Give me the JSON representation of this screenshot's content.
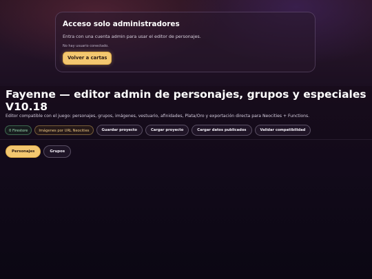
{
  "login": {
    "title": "Acceso solo administradores",
    "description": "Entra con una cuenta admin para usar el editor de personajes.",
    "status": "No hay usuario conectado.",
    "back_button": "Volver a cartas"
  },
  "header": {
    "title": "Fayenne — editor admin de personajes, grupos y especiales V10.18",
    "subtitle": "Editor compatible con el juego: personajes, grupos, imágenes, vestuario, afinidades, Plata/Oro y exportación directa para Neocities + Functions."
  },
  "toolbar": {
    "status_badge": "0 Firestore",
    "mode_badge": "Imágenes por URL Neocities",
    "save_project": "Guardar proyecto",
    "load_project": "Cargar proyecto",
    "load_published": "Cargar datos publicados",
    "validate": "Validar compatibilidad"
  },
  "tabs": [
    {
      "label": "Personajes",
      "active": true
    },
    {
      "label": "Grupos",
      "active": false
    }
  ],
  "colors": {
    "accent": "#f3c770",
    "background": "#120a1a",
    "status_green": "#9fe0b4",
    "status_amber": "#f0cc86"
  }
}
